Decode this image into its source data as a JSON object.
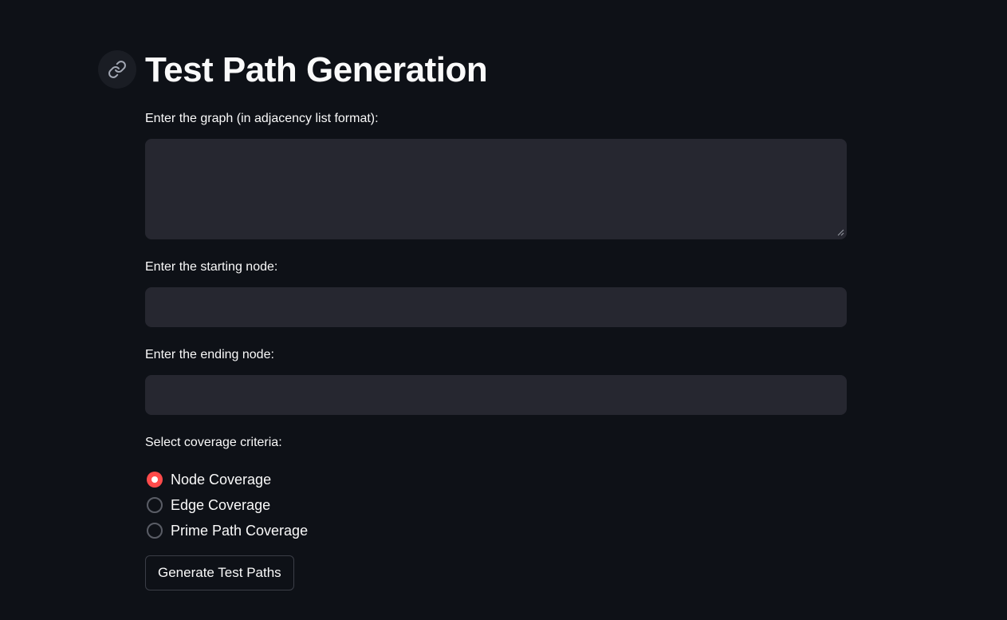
{
  "page": {
    "title": "Test Path Generation",
    "anchor_icon": "link-icon"
  },
  "form": {
    "graph_label": "Enter the graph (in adjacency list format):",
    "graph_value": "",
    "start_label": "Enter the starting node:",
    "start_value": "",
    "end_label": "Enter the ending node:",
    "end_value": "",
    "coverage_label": "Select coverage criteria:",
    "coverage_options": [
      {
        "label": "Node Coverage",
        "selected": true
      },
      {
        "label": "Edge Coverage",
        "selected": false
      },
      {
        "label": "Prime Path Coverage",
        "selected": false
      }
    ],
    "submit_label": "Generate Test Paths"
  },
  "colors": {
    "background": "#0e1117",
    "input_background": "#262730",
    "accent": "#ff4b4b",
    "text": "#fafafa"
  }
}
